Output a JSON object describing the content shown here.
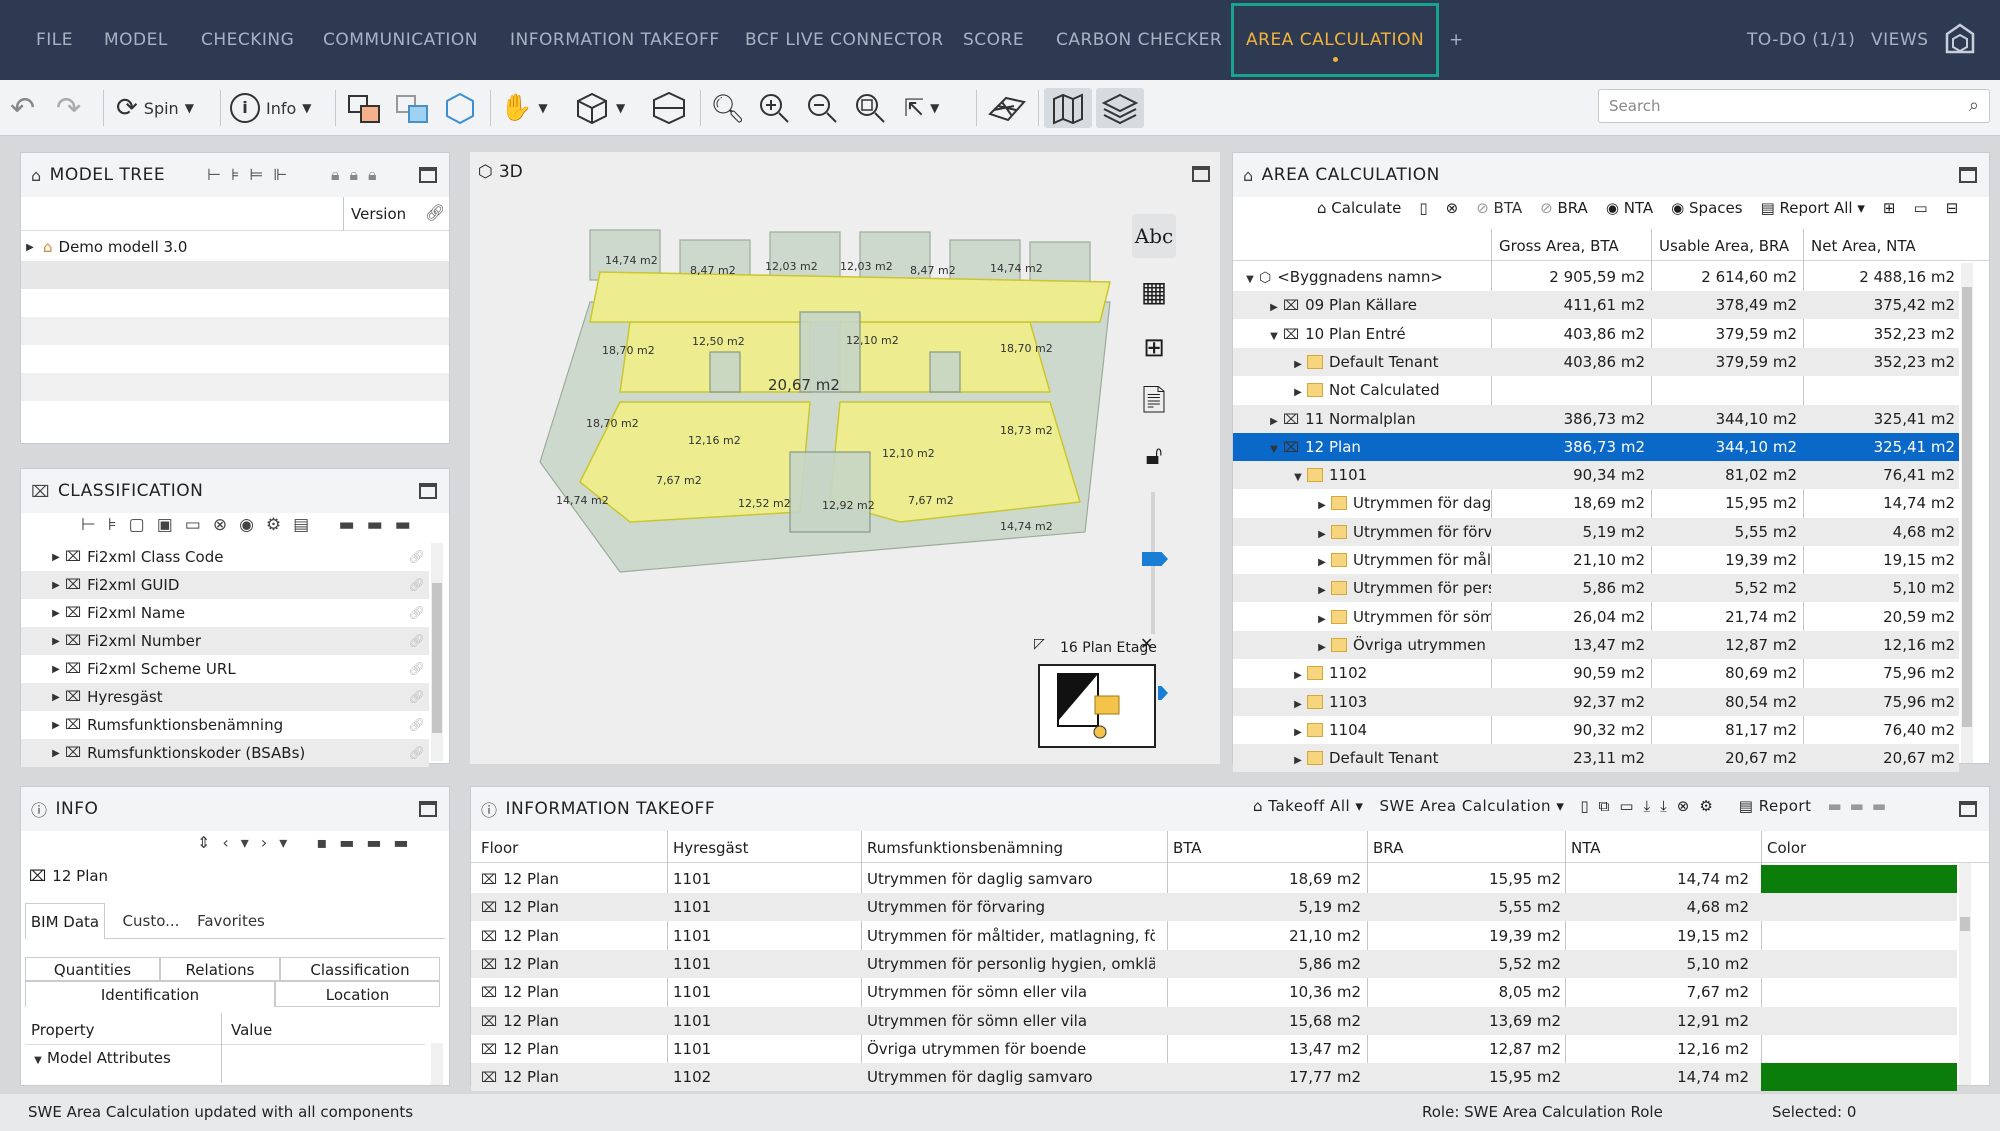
{
  "menu": {
    "tabs": [
      "FILE",
      "MODEL",
      "CHECKING",
      "COMMUNICATION",
      "INFORMATION TAKEOFF",
      "BCF LIVE CONNECTOR",
      "SCORE",
      "CARBON CHECKER",
      "AREA CALCULATION"
    ],
    "active_tab": "AREA CALCULATION",
    "add_tab": "+",
    "todo": "TO-DO (1/1)",
    "views": "VIEWS"
  },
  "toolbar": {
    "spin_label": "Spin",
    "info_label": "Info",
    "search_placeholder": "Search"
  },
  "model_tree": {
    "title": "MODEL TREE",
    "col_version": "Version",
    "items": [
      {
        "label": "Demo modell 3.0"
      }
    ]
  },
  "classification": {
    "title": "CLASSIFICATION",
    "items": [
      "Fi2xml Class Code",
      "Fi2xml GUID",
      "Fi2xml Name",
      "Fi2xml Number",
      "Fi2xml Scheme URL",
      "Hyresgäst",
      "Rumsfunktionsbenämning",
      "Rumsfunktionskoder (BSABs)"
    ]
  },
  "viewport": {
    "title": "3D",
    "room_labels": [
      "14,74 m2",
      "8,47 m2",
      "12,03 m2",
      "12,03 m2",
      "8,47 m2",
      "14,74 m2",
      "18,70 m2",
      "12,50 m2",
      "12,10 m2",
      "18,70 m2",
      "20,67 m2",
      "18,70 m2",
      "18,73 m2",
      "12,16 m2",
      "12,10 m2",
      "14,74 m2",
      "7,67 m2",
      "12,52 m2",
      "12,92 m2",
      "7,67 m2",
      "14,74 m2"
    ],
    "minimap_title": "16 Plan Etage",
    "side_text": "Abc"
  },
  "area_calc": {
    "title": "AREA CALCULATION",
    "actions": {
      "calculate": "Calculate",
      "bta": "BTA",
      "bra": "BRA",
      "nta": "NTA",
      "spaces": "Spaces",
      "report_all": "Report All"
    },
    "columns": [
      "Gross Area, BTA",
      "Usable Area, BRA",
      "Net Area, NTA"
    ],
    "rows": [
      {
        "name": "<Byggnadens namn>",
        "bta": "2 905,59 m2",
        "bra": "2 614,60 m2",
        "nta": "2 488,16 m2"
      },
      {
        "name": "09 Plan Källare",
        "bta": "411,61 m2",
        "bra": "378,49 m2",
        "nta": "375,42 m2"
      },
      {
        "name": "10 Plan Entré",
        "bta": "403,86 m2",
        "bra": "379,59 m2",
        "nta": "352,23 m2"
      },
      {
        "name": "Default Tenant",
        "bta": "403,86 m2",
        "bra": "379,59 m2",
        "nta": "352,23 m2"
      },
      {
        "name": "Not Calculated",
        "bta": "",
        "bra": "",
        "nta": ""
      },
      {
        "name": "11 Normalplan",
        "bta": "386,73 m2",
        "bra": "344,10 m2",
        "nta": "325,41 m2"
      },
      {
        "name": "12 Plan",
        "bta": "386,73 m2",
        "bra": "344,10 m2",
        "nta": "325,41 m2"
      },
      {
        "name": "1101",
        "bta": "90,34 m2",
        "bra": "81,02 m2",
        "nta": "76,41 m2"
      },
      {
        "name": "Utrymmen för dagli",
        "bta": "18,69 m2",
        "bra": "15,95 m2",
        "nta": "14,74 m2"
      },
      {
        "name": "Utrymmen för förva",
        "bta": "5,19 m2",
        "bra": "5,55 m2",
        "nta": "4,68 m2"
      },
      {
        "name": "Utrymmen för målti",
        "bta": "21,10 m2",
        "bra": "19,39 m2",
        "nta": "19,15 m2"
      },
      {
        "name": "Utrymmen för perso",
        "bta": "5,86 m2",
        "bra": "5,52 m2",
        "nta": "5,10 m2"
      },
      {
        "name": "Utrymmen för sömn",
        "bta": "26,04 m2",
        "bra": "21,74 m2",
        "nta": "20,59 m2"
      },
      {
        "name": "Övriga utrymmen fö",
        "bta": "13,47 m2",
        "bra": "12,87 m2",
        "nta": "12,16 m2"
      },
      {
        "name": "1102",
        "bta": "90,59 m2",
        "bra": "80,69 m2",
        "nta": "75,96 m2"
      },
      {
        "name": "1103",
        "bta": "92,37 m2",
        "bra": "80,54 m2",
        "nta": "75,96 m2"
      },
      {
        "name": "1104",
        "bta": "90,32 m2",
        "bra": "81,17 m2",
        "nta": "76,40 m2"
      },
      {
        "name": "Default Tenant",
        "bta": "23,11 m2",
        "bra": "20,67 m2",
        "nta": "20,67 m2"
      }
    ]
  },
  "info": {
    "title": "INFO",
    "object": "12 Plan",
    "tabs": [
      "BIM Data",
      "Custo...",
      "Favorites"
    ],
    "subtabs": [
      "Quantities",
      "Relations",
      "Classification",
      "Identification",
      "Location"
    ],
    "col_property": "Property",
    "col_value": "Value",
    "group": "Model Attributes"
  },
  "takeoff": {
    "title": "INFORMATION TAKEOFF",
    "takeoff_all": "Takeoff All",
    "preset": "SWE Area Calculation",
    "report": "Report",
    "columns": [
      "Floor",
      "Hyresgäst",
      "Rumsfunktionsbenämning",
      "BTA",
      "BRA",
      "NTA",
      "Color"
    ],
    "rows": [
      {
        "floor": "12 Plan",
        "tenant": "1101",
        "func": "Utrymmen för daglig samvaro",
        "bta": "18,69 m2",
        "bra": "15,95 m2",
        "nta": "14,74 m2",
        "color": "#0a7d0a"
      },
      {
        "floor": "12 Plan",
        "tenant": "1101",
        "func": "Utrymmen för förvaring",
        "bta": "5,19 m2",
        "bra": "5,55 m2",
        "nta": "4,68 m2",
        "color": ""
      },
      {
        "floor": "12 Plan",
        "tenant": "1101",
        "func": "Utrymmen för måltider, matlagning, förv...",
        "bta": "21,10 m2",
        "bra": "19,39 m2",
        "nta": "19,15 m2",
        "color": ""
      },
      {
        "floor": "12 Plan",
        "tenant": "1101",
        "func": "Utrymmen för personlig hygien, omklädn...",
        "bta": "5,86 m2",
        "bra": "5,52 m2",
        "nta": "5,10 m2",
        "color": ""
      },
      {
        "floor": "12 Plan",
        "tenant": "1101",
        "func": "Utrymmen för sömn eller vila",
        "bta": "10,36 m2",
        "bra": "8,05 m2",
        "nta": "7,67 m2",
        "color": ""
      },
      {
        "floor": "12 Plan",
        "tenant": "1101",
        "func": "Utrymmen för sömn eller vila",
        "bta": "15,68 m2",
        "bra": "13,69 m2",
        "nta": "12,91 m2",
        "color": ""
      },
      {
        "floor": "12 Plan",
        "tenant": "1101",
        "func": "Övriga utrymmen för boende",
        "bta": "13,47 m2",
        "bra": "12,87 m2",
        "nta": "12,16 m2",
        "color": ""
      },
      {
        "floor": "12 Plan",
        "tenant": "1102",
        "func": "Utrymmen för daglig samvaro",
        "bta": "17,77 m2",
        "bra": "15,95 m2",
        "nta": "14,74 m2",
        "color": "#0a7d0a"
      }
    ]
  },
  "status": {
    "message": "SWE Area Calculation updated with all components",
    "role": "Role: SWE Area Calculation Role",
    "selected": "Selected: 0"
  }
}
